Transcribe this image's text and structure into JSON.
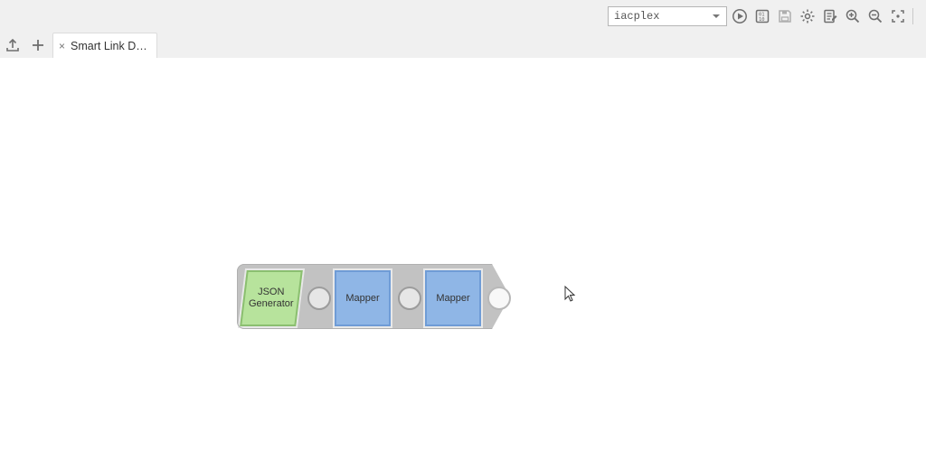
{
  "toolbar": {
    "dropdown_value": "iacplex"
  },
  "tab": {
    "label": "Smart Link D…"
  },
  "pipeline": {
    "nodes": [
      {
        "label": "JSON\nGenerator"
      },
      {
        "label": "Mapper"
      },
      {
        "label": "Mapper"
      }
    ]
  }
}
